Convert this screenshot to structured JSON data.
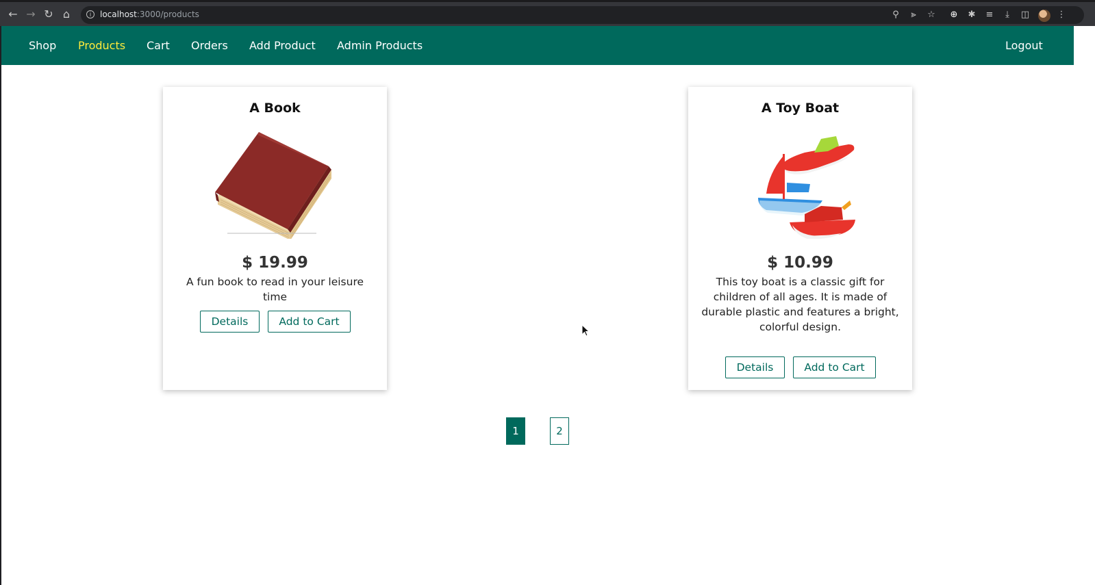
{
  "browser": {
    "url_host": "localhost",
    "url_path": ":3000/products",
    "icons": [
      "back-icon",
      "forward-icon",
      "reload-icon",
      "home-icon",
      "info-icon",
      "zoom-icon",
      "share-icon",
      "bookmark-star-icon",
      "extension-plus-icon",
      "extensions-puzzle-icon",
      "media-control-icon",
      "download-icon",
      "sidepanel-icon",
      "profile-avatar",
      "menu-dots-icon"
    ]
  },
  "nav": {
    "items": [
      {
        "label": "Shop",
        "active": false
      },
      {
        "label": "Products",
        "active": true
      },
      {
        "label": "Cart",
        "active": false
      },
      {
        "label": "Orders",
        "active": false
      },
      {
        "label": "Add Product",
        "active": false
      },
      {
        "label": "Admin Products",
        "active": false
      }
    ],
    "logout": "Logout",
    "active_color": "#ffeb3b",
    "bar_color": "#00695c"
  },
  "products": [
    {
      "title": "A Book",
      "image": "book-image",
      "price": "$ 19.99",
      "description": "A fun book to read in your leisure time",
      "details_label": "Details",
      "cart_label": "Add to Cart"
    },
    {
      "title": "A Toy Boat",
      "image": "toy-boats-image",
      "price": "$ 10.99",
      "description": "This toy boat is a classic gift for children of all ages. It is made of durable plastic and features a bright, colorful design.",
      "details_label": "Details",
      "cart_label": "Add to Cart"
    }
  ],
  "pagination": {
    "pages": [
      "1",
      "2"
    ],
    "current": "1"
  }
}
